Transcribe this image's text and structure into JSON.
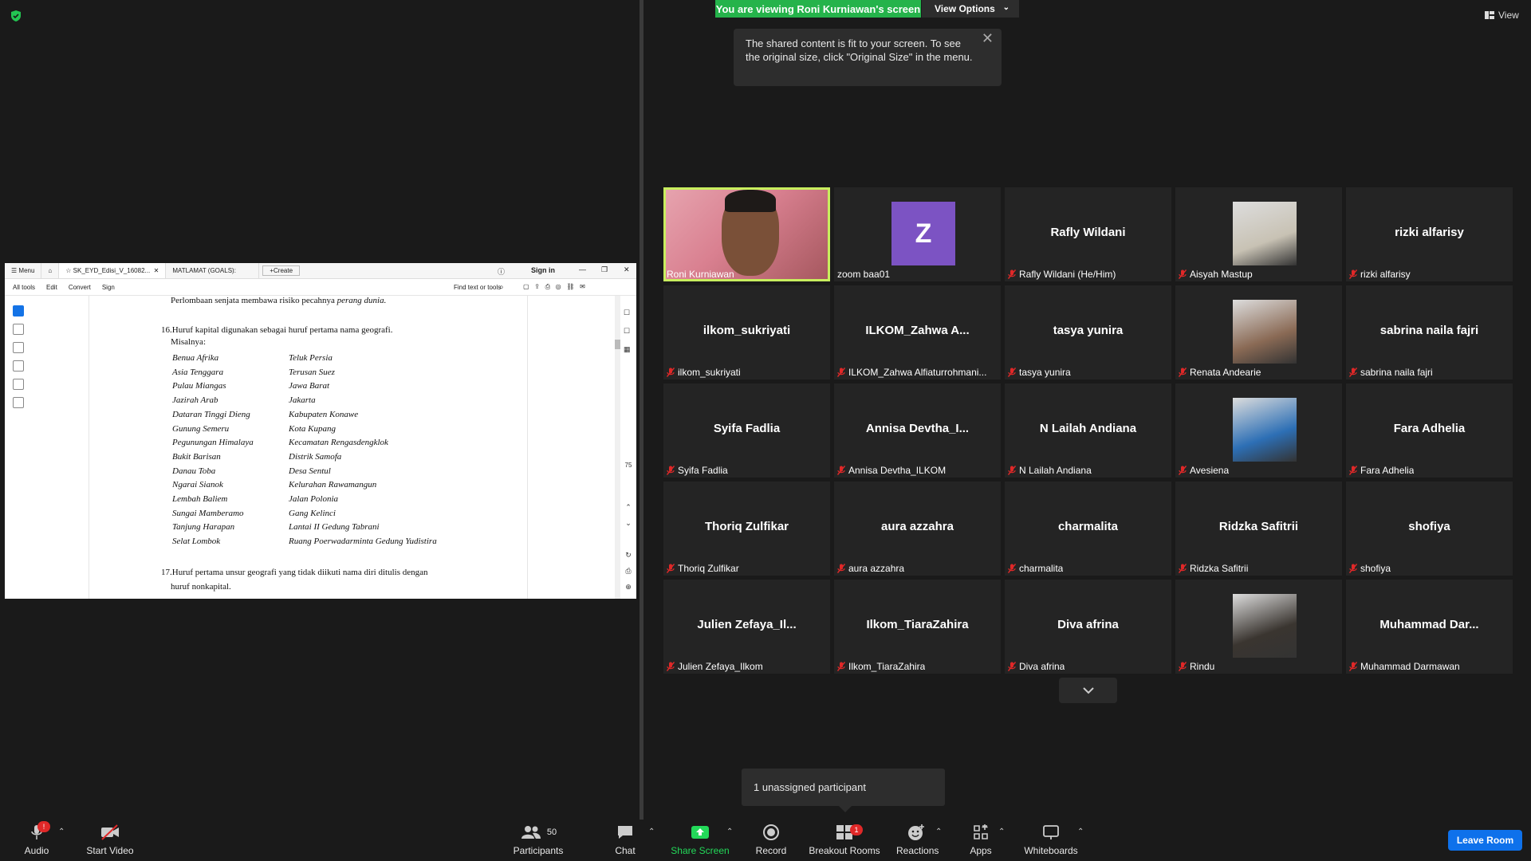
{
  "banner": {
    "viewing": "You are viewing Roni Kurniawan's screen",
    "view_options": "View Options"
  },
  "tooltip": {
    "text": "The shared content is fit to your screen. To see the original size, click \"Original Size\" in the menu."
  },
  "top_right": {
    "view": "View"
  },
  "shared_window": {
    "tabs": [
      "Menu",
      "SK_EYD_Edisi_V_16082...",
      "MATLAMAT (GOALS):",
      "Create"
    ],
    "sign_in": "Sign in",
    "menu_items": [
      "All tools",
      "Edit",
      "Convert",
      "Sign"
    ],
    "find": "Find text or tools",
    "page_num": "75",
    "doc": {
      "line0_plain": "Perlombaan senjata membawa risiko pecahnya ",
      "line0_italic": "perang dunia.",
      "rule16": "16.Huruf kapital digunakan sebagai huruf pertama nama geografi.",
      "misalnya": "Misalnya:",
      "left_col": [
        "Benua Afrika",
        "Asia Tenggara",
        "Pulau Miangas",
        "Jazirah Arab",
        "Dataran Tinggi Dieng",
        "Gunung Semeru",
        "Pegunungan Himalaya",
        "Bukit Barisan",
        "Danau Toba",
        "Ngarai Sianok",
        "Lembah Baliem",
        "Sungai Mamberamo",
        "Tanjung Harapan",
        "Selat Lombok"
      ],
      "right_col": [
        "Teluk Persia",
        "Terusan Suez",
        "Jawa Barat",
        "Jakarta",
        "Kabupaten Konawe",
        "Kota Kupang",
        "Kecamatan Rengasdengklok",
        "Distrik Samofa",
        "Desa Sentul",
        "Kelurahan Rawamangun",
        "Jalan Polonia",
        "Gang Kelinci",
        "Lantai II Gedung Tabrani",
        "Ruang Poerwadarminta Gedung Yudistira"
      ],
      "rule17a": "17.Huruf pertama unsur geografi yang tidak diikuti nama diri ditulis dengan",
      "rule17b": "huruf nonkapital."
    }
  },
  "participants": [
    {
      "big": "",
      "caption": "Roni Kurniawan",
      "muted": false,
      "video": "face",
      "active": true
    },
    {
      "big": "",
      "caption": "zoom baa01",
      "muted": false,
      "video": "letter",
      "letter": "Z"
    },
    {
      "big": "Rafly Wildani",
      "caption": "Rafly Wildani (He/Him)",
      "muted": true
    },
    {
      "big": "",
      "caption": "Aisyah Mastup",
      "muted": true,
      "video": "photo",
      "color": "#c8c2b4"
    },
    {
      "big": "rizki alfarisy",
      "caption": "rizki alfarisy",
      "muted": true
    },
    {
      "big": "ilkom_sukriyati",
      "caption": "ilkom_sukriyati",
      "muted": true
    },
    {
      "big": "ILKOM_Zahwa  A...",
      "caption": "ILKOM_Zahwa Alfiaturrohmani...",
      "muted": true
    },
    {
      "big": "tasya yunira",
      "caption": "tasya yunira",
      "muted": true
    },
    {
      "big": "",
      "caption": "Renata Andearie",
      "muted": true,
      "video": "photo",
      "color": "#8a6a55"
    },
    {
      "big": "sabrina naila fajri",
      "caption": "sabrina naila fajri",
      "muted": true
    },
    {
      "big": "Syifa Fadlia",
      "caption": "Syifa Fadlia",
      "muted": true
    },
    {
      "big": "Annisa  Devtha_I...",
      "caption": "Annisa Devtha_ILKOM",
      "muted": true
    },
    {
      "big": "N Lailah Andiana",
      "caption": "N Lailah Andiana",
      "muted": true
    },
    {
      "big": "",
      "caption": "Avesiena",
      "muted": true,
      "video": "photo",
      "color": "#2d6fb5"
    },
    {
      "big": "Fara Adhelia",
      "caption": "Fara Adhelia",
      "muted": true
    },
    {
      "big": "Thoriq Zulfikar",
      "caption": "Thoriq Zulfikar",
      "muted": true
    },
    {
      "big": "aura azzahra",
      "caption": "aura azzahra",
      "muted": true
    },
    {
      "big": "charmalita",
      "caption": "charmalita",
      "muted": true
    },
    {
      "big": "Ridzka Safitrii",
      "caption": "Ridzka Safitrii",
      "muted": true
    },
    {
      "big": "shofiya",
      "caption": "shofiya",
      "muted": true
    },
    {
      "big": "Julien  Zefaya_Il...",
      "caption": "Julien Zefaya_Ilkom",
      "muted": true
    },
    {
      "big": "Ilkom_TiaraZahira",
      "caption": "Ilkom_TiaraZahira",
      "muted": true
    },
    {
      "big": "Diva afrina",
      "caption": "Diva afrina",
      "muted": true
    },
    {
      "big": "",
      "caption": "Rindu",
      "muted": true,
      "video": "photo",
      "color": "#3a3530"
    },
    {
      "big": "Muhammad  Dar...",
      "caption": "Muhammad Darmawan",
      "muted": true
    }
  ],
  "unassigned": "1 unassigned participant",
  "toolbar": {
    "audio": "Audio",
    "start_video": "Start Video",
    "participants": "Participants",
    "participants_count": "50",
    "chat": "Chat",
    "share_screen": "Share Screen",
    "record": "Record",
    "breakout": "Breakout Rooms",
    "breakout_badge": "1",
    "audio_badge": "!",
    "reactions": "Reactions",
    "apps": "Apps",
    "whiteboards": "Whiteboards",
    "leave": "Leave Room"
  },
  "colors": {
    "share_green": "#23d959",
    "leave_blue": "#0e71eb",
    "active_speaker": "#c8ee5e",
    "mute_red": "#e02828"
  }
}
